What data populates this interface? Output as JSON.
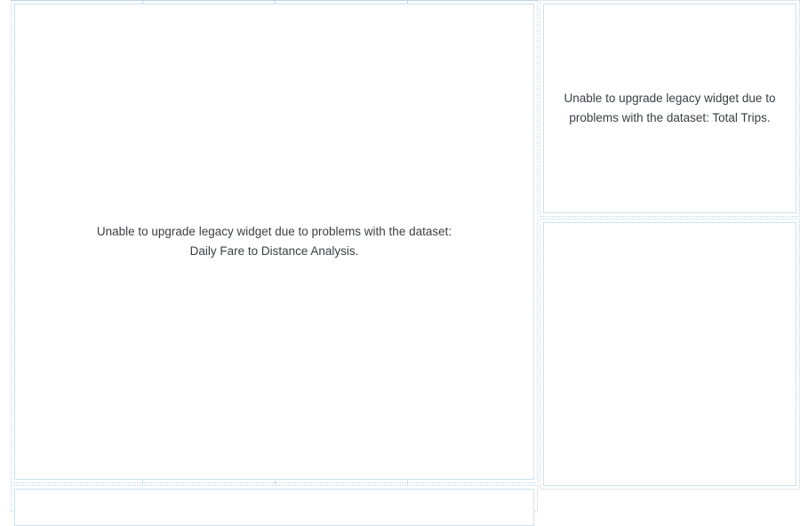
{
  "widgets": {
    "left": {
      "error": "Unable to upgrade legacy widget due to problems with the dataset: Daily Fare to Distance Analysis."
    },
    "topRight": {
      "error": "Unable to upgrade legacy widget due to problems with the dataset: Total Trips."
    },
    "bottomRight": {
      "error": ""
    }
  }
}
